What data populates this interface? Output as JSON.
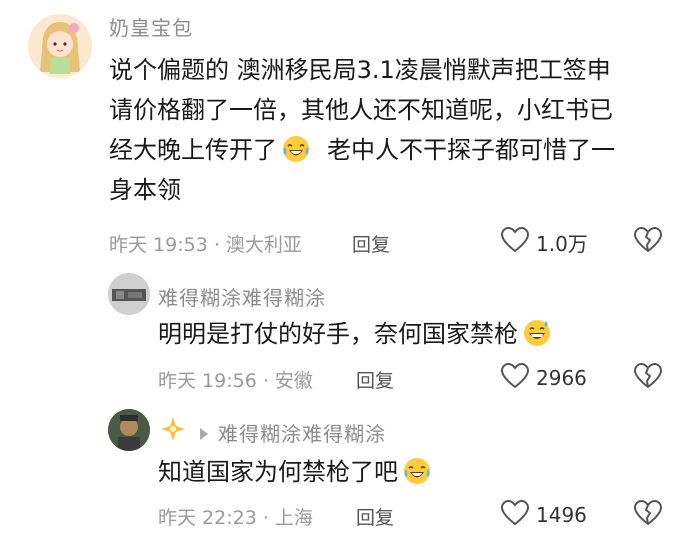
{
  "comments": [
    {
      "username": "奶皇宝包",
      "lines": [
        "说个偏题的 澳洲移民局3.1凌晨悄默声把工签申",
        "请价格翻了一倍，其他人还不知道呢，小红书已",
        "经大晚上传开了",
        "老中人不干探子都可惜了一",
        "身本领"
      ],
      "time_location": "昨天 19:53 · 澳大利亚",
      "reply_label": "回复",
      "likes": "1.0万",
      "emoji": "laughing-crying-emoji"
    }
  ],
  "replies": [
    {
      "username": "难得糊涂难得糊涂",
      "text": "明明是打仗的好手，奈何国家禁枪",
      "time_location": "昨天 19:56 · 安徽",
      "reply_label": "回复",
      "likes": "2966",
      "emoji": "grinning-sweat-emoji"
    },
    {
      "username": "难得糊涂难得糊涂",
      "text": "知道国家为何禁枪了吧",
      "time_location": "昨天 22:23 · 上海",
      "reply_label": "回复",
      "likes": "1496",
      "emoji": "laughing-crying-emoji"
    }
  ],
  "icons": [
    "heart-icon",
    "broken-heart-icon",
    "sparkle-badge-icon",
    "reply-arrow-icon"
  ]
}
